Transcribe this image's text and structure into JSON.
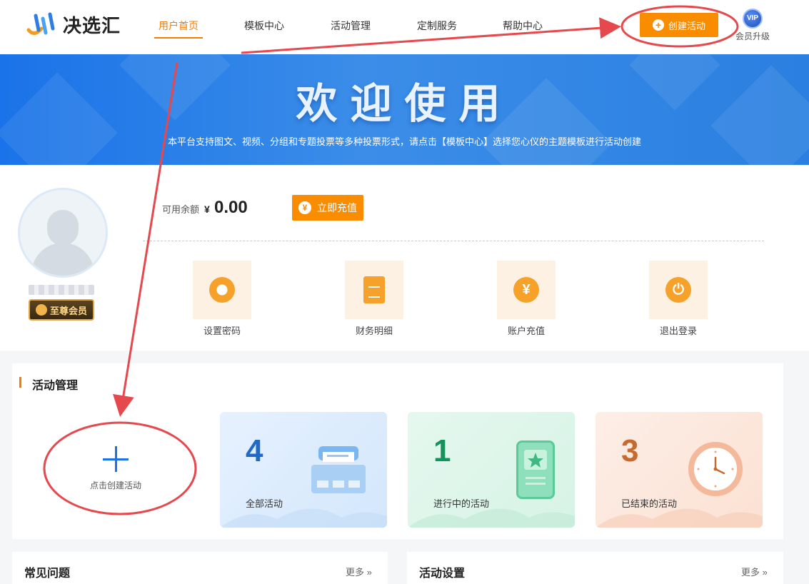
{
  "header": {
    "logo_text": "决选汇",
    "nav": [
      "用户首页",
      "模板中心",
      "活动管理",
      "定制服务",
      "帮助中心"
    ],
    "create_button": "创建活动",
    "vip_badge": "VIP",
    "vip_label": "会员升级"
  },
  "banner": {
    "title": "欢迎使用",
    "subtitle": "本平台支持图文、视频、分组和专题投票等多种投票形式，请点击【模板中心】选择您心仪的主题模板进行活动创建"
  },
  "profile": {
    "member_level": "至尊会员",
    "balance_label": "可用余额",
    "currency": "¥",
    "balance": "0.00",
    "recharge_button": "立即充值",
    "quick_actions": [
      "设置密码",
      "财务明细",
      "账户充值",
      "退出登录"
    ]
  },
  "activity": {
    "title": "活动管理",
    "create_label": "点击创建活动",
    "stats": [
      {
        "value": "4",
        "label": "全部活动"
      },
      {
        "value": "1",
        "label": "进行中的活动"
      },
      {
        "value": "3",
        "label": "已结束的活动"
      }
    ]
  },
  "panels": {
    "faq_title": "常见问题",
    "settings_title": "活动设置",
    "more": "更多 »"
  },
  "colors": {
    "accent": "#fa8c00",
    "banner": "#2a7fe0",
    "annotation": "#e5484d"
  }
}
